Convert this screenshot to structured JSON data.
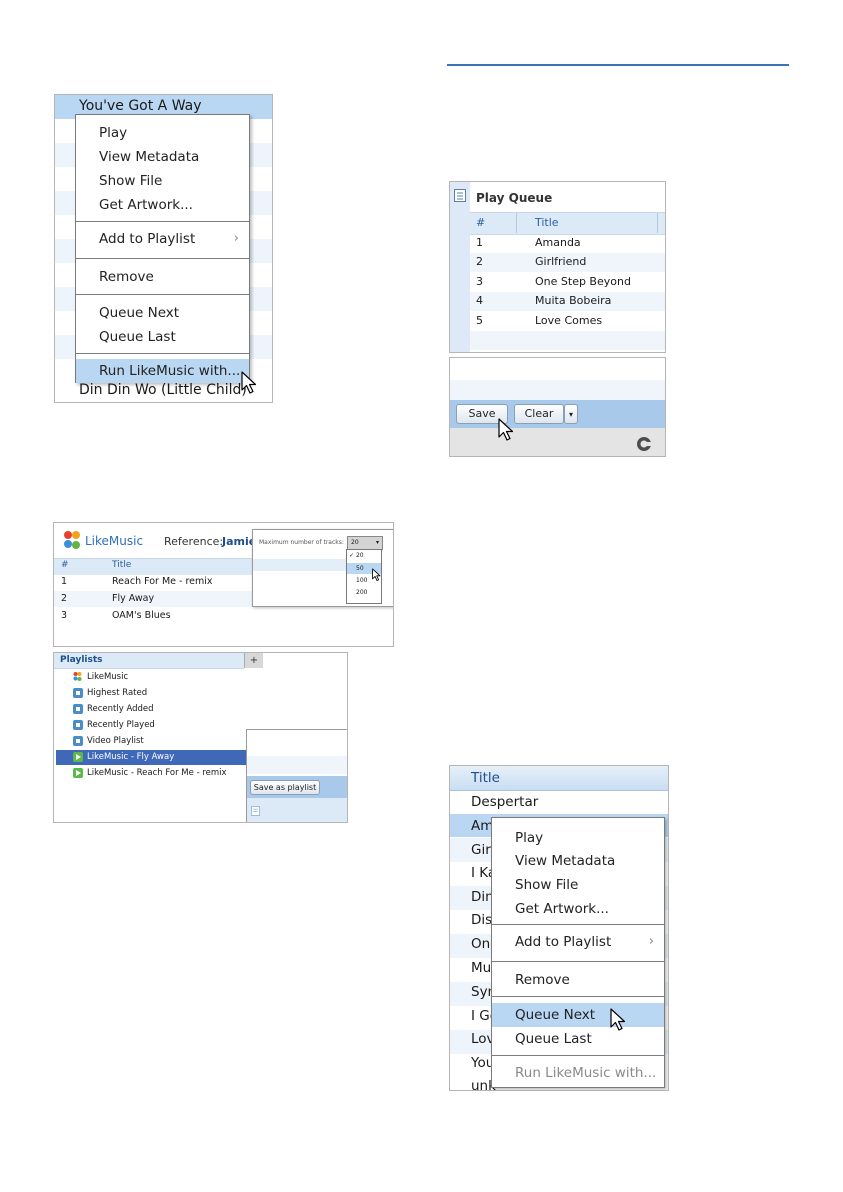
{
  "panel_a": {
    "header_row": "You've Got A Way",
    "bottom_row": "Din Din Wo (Little Child)",
    "menu": {
      "play": "Play",
      "view_metadata": "View Metadata",
      "show_file": "Show File",
      "get_artwork": "Get Artwork...",
      "add_to_playlist": "Add to Playlist",
      "remove": "Remove",
      "queue_next": "Queue Next",
      "queue_last": "Queue Last",
      "run_likemusic": "Run LikeMusic with..."
    }
  },
  "play_queue": {
    "title": "Play Queue",
    "col_num": "#",
    "col_title": "Title",
    "rows": [
      {
        "num": "1",
        "title": "Amanda"
      },
      {
        "num": "2",
        "title": "Girlfriend"
      },
      {
        "num": "3",
        "title": "One Step Beyond"
      },
      {
        "num": "4",
        "title": "Muita Bobeira"
      },
      {
        "num": "5",
        "title": "Love Comes"
      }
    ],
    "save_label": "Save",
    "clear_label": "Clear"
  },
  "likemusic": {
    "logo_text": "LikeMusic",
    "reference_label": "Reference:",
    "reference_value": "Jamie",
    "col_num": "#",
    "col_title": "Title",
    "rows": [
      {
        "num": "1",
        "title": "Reach For Me - remix"
      },
      {
        "num": "2",
        "title": "Fly Away"
      },
      {
        "num": "3",
        "title": "OAM's Blues"
      }
    ],
    "max_tracks_label": "Maximum number of tracks:",
    "max_tracks_value": "20",
    "options": [
      "20",
      "50",
      "100",
      "200"
    ],
    "selected_option": "20"
  },
  "playlists": {
    "header": "Playlists",
    "add_symbol": "+",
    "items": [
      {
        "label": "LikeMusic",
        "icon": "likemusic-logo-icon"
      },
      {
        "label": "Highest Rated",
        "icon": "home-playlist-icon"
      },
      {
        "label": "Recently Added",
        "icon": "home-playlist-icon"
      },
      {
        "label": "Recently Played",
        "icon": "home-playlist-icon"
      },
      {
        "label": "Video Playlist",
        "icon": "home-playlist-icon"
      },
      {
        "label": "LikeMusic - Fly Away",
        "icon": "play-playlist-icon"
      },
      {
        "label": "LikeMusic - Reach For Me - remix",
        "icon": "play-playlist-icon"
      }
    ],
    "save_as_playlist": "Save as playlist"
  },
  "panel_d": {
    "header": "Title",
    "rows": [
      "Despertar",
      "Am",
      "Girl",
      "I Ka",
      "Din",
      "Dist",
      "One",
      "Mui",
      "Syn",
      "I Go",
      "Lov",
      "You",
      "unk"
    ],
    "menu": {
      "play": "Play",
      "view_metadata": "View Metadata",
      "show_file": "Show File",
      "get_artwork": "Get Artwork...",
      "add_to_playlist": "Add to Playlist",
      "remove": "Remove",
      "queue_next": "Queue Next",
      "queue_last": "Queue Last",
      "run_likemusic": "Run LikeMusic with..."
    }
  },
  "colors": {
    "row_highlight": "#b9d7f3",
    "header_blue": "#1f4e8c",
    "selected_row": "#3f68b8",
    "rule_blue": "#3b73b9"
  }
}
